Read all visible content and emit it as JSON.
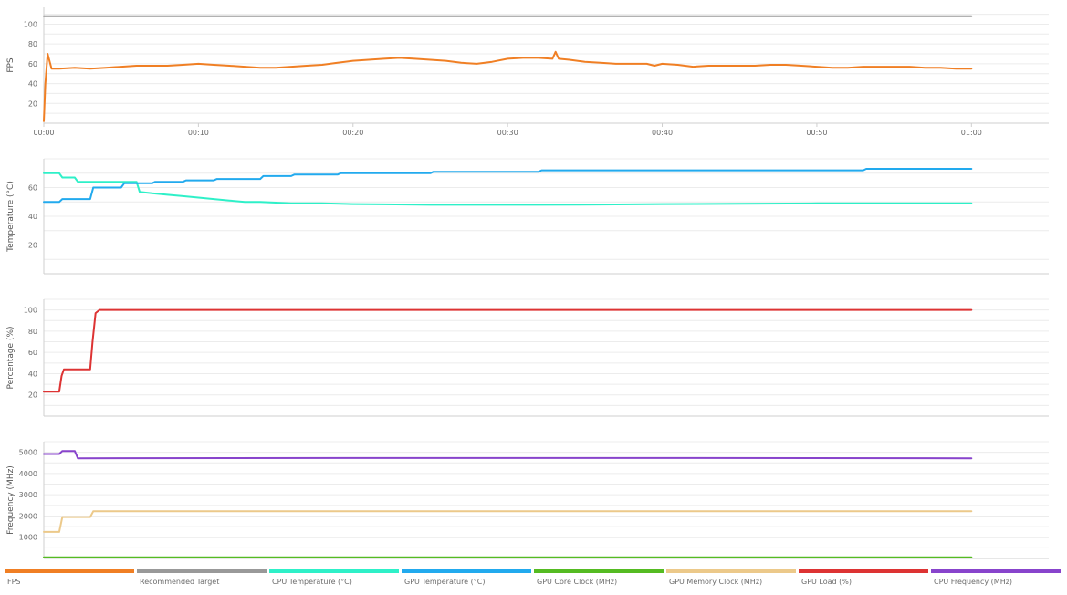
{
  "colors": {
    "fps": "#f07f24",
    "target": "#999999",
    "cpu_temp": "#2ef0c8",
    "gpu_temp": "#22aaee",
    "gpu_core": "#55bb22",
    "gpu_mem": "#ecc98a",
    "gpu_load": "#dd3333",
    "cpu_freq": "#8844cc"
  },
  "legend": [
    {
      "label": "FPS",
      "color": "#f07f24"
    },
    {
      "label": "Recommended Target",
      "color": "#999999"
    },
    {
      "label": "CPU Temperature (°C)",
      "color": "#2ef0c8"
    },
    {
      "label": "GPU Temperature (°C)",
      "color": "#22aaee"
    },
    {
      "label": "GPU Core Clock (MHz)",
      "color": "#55bb22"
    },
    {
      "label": "GPU Memory Clock (MHz)",
      "color": "#ecc98a"
    },
    {
      "label": "GPU Load (%)",
      "color": "#dd3333"
    },
    {
      "label": "CPU Frequency (MHz)",
      "color": "#8844cc"
    }
  ],
  "chart_data": [
    {
      "type": "line",
      "ylabel": "FPS",
      "ylim": [
        0,
        117
      ],
      "xlim": [
        0,
        65
      ],
      "yticks": [
        20,
        40,
        60,
        80,
        100
      ],
      "xticks": [
        "00:00",
        "00:10",
        "00:20",
        "00:30",
        "00:40",
        "00:50",
        "01:00"
      ],
      "xtick_values": [
        0,
        10,
        20,
        30,
        40,
        50,
        60
      ],
      "grid": true,
      "series": [
        {
          "name": "Recommended Target",
          "color": "#999999",
          "x": [
            0,
            60
          ],
          "y": [
            108,
            108
          ]
        },
        {
          "name": "FPS",
          "color": "#f07f24",
          "x": [
            0,
            0.1,
            0.25,
            0.5,
            1,
            2,
            3,
            4,
            5,
            6,
            7,
            8,
            9,
            10,
            11,
            12,
            13,
            14,
            15,
            16,
            17,
            18,
            19,
            20,
            21,
            22,
            23,
            24,
            25,
            26,
            27,
            28,
            29,
            30,
            31,
            32,
            32.9,
            33.1,
            33.3,
            34,
            35,
            36,
            37,
            38,
            39,
            39.5,
            40,
            41,
            42,
            43,
            44,
            45,
            46,
            47,
            48,
            49,
            50,
            51,
            52,
            53,
            54,
            55,
            56,
            57,
            58,
            59,
            60
          ],
          "y": [
            2,
            40,
            70,
            55,
            55,
            56,
            55,
            56,
            57,
            58,
            58,
            58,
            59,
            60,
            59,
            58,
            57,
            56,
            56,
            57,
            58,
            59,
            61,
            63,
            64,
            65,
            66,
            65,
            64,
            63,
            61,
            60,
            62,
            65,
            66,
            66,
            65,
            72,
            65,
            64,
            62,
            61,
            60,
            60,
            60,
            58,
            60,
            59,
            57,
            58,
            58,
            58,
            58,
            59,
            59,
            58,
            57,
            56,
            56,
            57,
            57,
            57,
            57,
            56,
            56,
            55,
            55
          ]
        }
      ]
    },
    {
      "type": "line",
      "ylabel": "Temperature (°C)",
      "ylim": [
        0,
        80
      ],
      "xlim": [
        0,
        65
      ],
      "yticks": [
        20,
        40,
        60
      ],
      "grid": true,
      "series": [
        {
          "name": "CPU Temperature (°C)",
          "color": "#2ef0c8",
          "x": [
            0,
            1,
            1.2,
            2,
            2.2,
            5,
            6,
            6.2,
            7,
            8,
            9,
            10,
            11,
            12,
            13,
            14,
            16,
            18,
            20,
            22,
            25,
            28,
            32,
            36,
            40,
            45,
            50,
            55,
            60
          ],
          "y": [
            70,
            70,
            67,
            67,
            64,
            64,
            64,
            57,
            56,
            55,
            54,
            53,
            52,
            51,
            50,
            50,
            49,
            49,
            48.5,
            48.3,
            48,
            48,
            48,
            48.2,
            48.5,
            48.7,
            49,
            49,
            49
          ]
        },
        {
          "name": "GPU Temperature (°C)",
          "color": "#22aaee",
          "x": [
            0,
            1,
            1.2,
            3,
            3.2,
            5,
            5.2,
            7,
            7.2,
            9,
            9.2,
            11,
            11.2,
            14,
            14.2,
            16,
            16.2,
            19,
            19.2,
            25,
            25.2,
            32,
            32.2,
            53,
            53.2,
            60
          ],
          "y": [
            50,
            50,
            52,
            52,
            60,
            60,
            63,
            63,
            64,
            64,
            65,
            65,
            66,
            66,
            68,
            68,
            69,
            69,
            70,
            70,
            71,
            71,
            72,
            72,
            73,
            73
          ]
        }
      ]
    },
    {
      "type": "line",
      "ylabel": "Percentage (%)",
      "ylim": [
        0,
        110
      ],
      "xlim": [
        0,
        65
      ],
      "yticks": [
        20,
        40,
        60,
        80,
        100
      ],
      "grid": true,
      "series": [
        {
          "name": "GPU Load (%)",
          "color": "#dd3333",
          "x": [
            0,
            1,
            1.15,
            1.3,
            3,
            3.15,
            3.35,
            3.6,
            60
          ],
          "y": [
            23,
            23,
            38,
            44,
            44,
            70,
            97,
            100,
            100
          ]
        }
      ]
    },
    {
      "type": "line",
      "ylabel": "Frequency (MHz)",
      "ylim": [
        0,
        5500
      ],
      "xlim": [
        0,
        65
      ],
      "yticks": [
        1000,
        2000,
        3000,
        4000,
        5000
      ],
      "grid": true,
      "series": [
        {
          "name": "GPU Core Clock (MHz)",
          "color": "#55bb22",
          "x": [
            0,
            60
          ],
          "y": [
            50,
            50
          ]
        },
        {
          "name": "GPU Memory Clock (MHz)",
          "color": "#ecc98a",
          "x": [
            0,
            1,
            1.2,
            3,
            3.2,
            60
          ],
          "y": [
            1250,
            1250,
            1950,
            1950,
            2220,
            2220
          ]
        },
        {
          "name": "CPU Frequency (MHz)",
          "color": "#8844cc",
          "x": [
            0,
            1,
            1.2,
            2,
            2.2,
            20,
            40,
            60
          ],
          "y": [
            4920,
            4920,
            5060,
            5060,
            4720,
            4730,
            4730,
            4720
          ]
        }
      ]
    }
  ]
}
